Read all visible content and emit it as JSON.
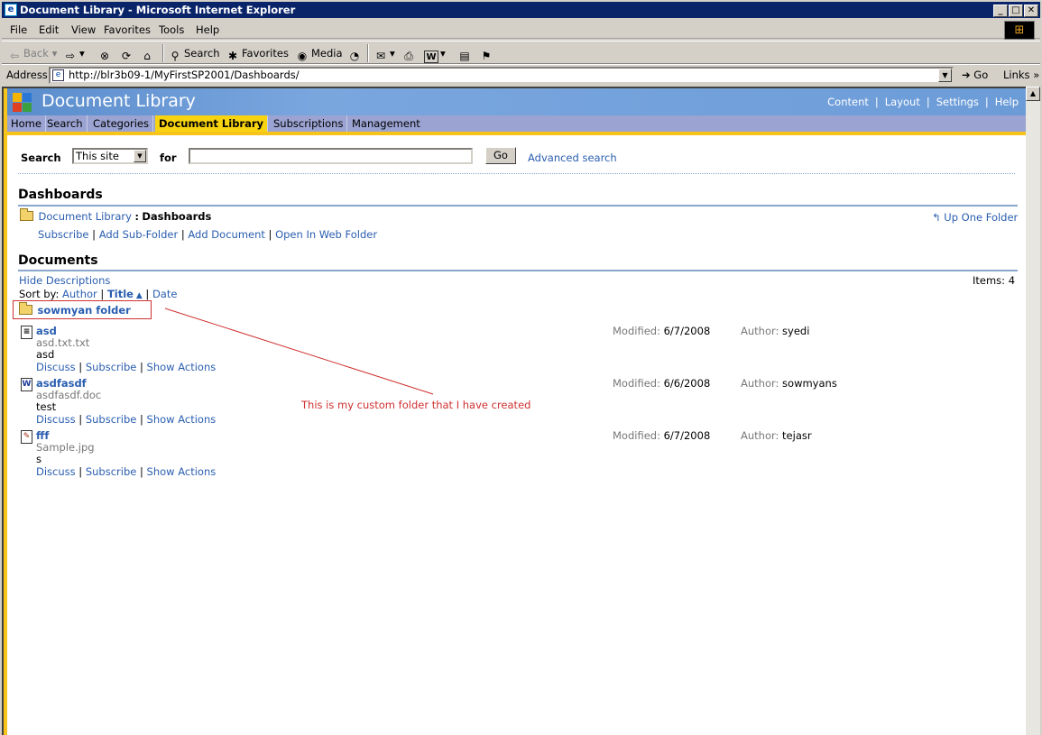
{
  "window": {
    "title": "Document Library - Microsoft Internet Explorer",
    "controls": [
      "_",
      "□",
      "✕"
    ]
  },
  "menu": [
    "File",
    "Edit",
    "View",
    "Favorites",
    "Tools",
    "Help"
  ],
  "toolbar": {
    "back": "Back",
    "search": "Search",
    "favorites": "Favorites",
    "media": "Media"
  },
  "address": {
    "label": "Address",
    "url": "http://blr3b09-1/MyFirstSP2001/Dashboards/",
    "go": "Go",
    "links": "Links"
  },
  "site": {
    "title": "Document Library",
    "top_links": [
      "Content",
      "Layout",
      "Settings",
      "Help"
    ],
    "nav": [
      "Home",
      "Search",
      "Categories",
      "Document Library",
      "Subscriptions",
      "Management"
    ],
    "active_nav": "Document Library",
    "logo_colors": [
      "#f4b400",
      "#2a77d4",
      "#e04020",
      "#3aa040"
    ]
  },
  "search": {
    "label": "Search",
    "scope": "This site",
    "for_label": "for",
    "query": "",
    "go": "Go",
    "advanced": "Advanced search"
  },
  "folder": {
    "heading": "Dashboards",
    "breadcrumb_parent": "Document Library",
    "breadcrumb_sep": ":",
    "breadcrumb_current": "Dashboards",
    "up_folder": "Up One Folder",
    "actions": [
      "Subscribe",
      "Add Sub-Folder",
      "Add Document",
      "Open In Web Folder"
    ]
  },
  "documents": {
    "heading": "Documents",
    "hide_desc": "Hide Descriptions",
    "items_count": "Items: 4",
    "sort_label": "Sort by:",
    "sort_options": [
      "Author",
      "Title",
      "Date"
    ],
    "sort_active": "Title",
    "subfolder": "sowmyan folder",
    "modified_label": "Modified:",
    "author_label": "Author:",
    "item_actions": [
      "Discuss",
      "Subscribe",
      "Show Actions"
    ],
    "list": [
      {
        "title": "asd",
        "file": "asd.txt.txt",
        "desc": "asd",
        "modified": "6/7/2008",
        "author": "syedi",
        "icon": "text-file-icon"
      },
      {
        "title": "asdfasdf",
        "file": "asdfasdf.doc",
        "desc": "test",
        "modified": "6/6/2008",
        "author": "sowmyans",
        "icon": "word-doc-icon"
      },
      {
        "title": "fff",
        "file": "Sample.jpg",
        "desc": "s",
        "modified": "6/7/2008",
        "author": "tejasr",
        "icon": "image-file-icon"
      }
    ]
  },
  "annotation": {
    "text": "This is my custom folder that I have created",
    "color": "#d03030"
  }
}
